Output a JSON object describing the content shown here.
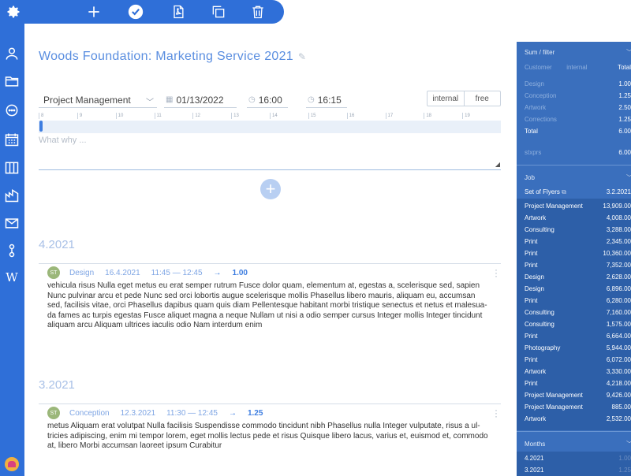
{
  "toolbar": {
    "icons": [
      "plus-icon",
      "check-circle-icon",
      "pdf-icon",
      "copy-icon",
      "trash-icon"
    ]
  },
  "sidebar": {
    "icons": [
      "gear-icon",
      "user-icon",
      "folder-icon",
      "chat-icon",
      "calendar-icon",
      "columns-icon",
      "factory-icon",
      "mail-icon",
      "link-icon",
      "wikipedia-icon"
    ]
  },
  "main": {
    "title": "Woods Foundation: Marketing Service 2021",
    "form": {
      "project": "Project Management",
      "date": "01/13/2022",
      "time_start": "16:00",
      "time_end": "16:15",
      "toggle": [
        "internal",
        "free"
      ],
      "placeholder": "What why ..."
    },
    "timeline_hours": [
      "8",
      "9",
      "10",
      "11",
      "12",
      "13",
      "14",
      "15",
      "16",
      "17",
      "18",
      "19"
    ],
    "groups": [
      {
        "month": "4.2021",
        "entry": {
          "initials": "ST",
          "type": "Design",
          "date": "16.4.2021",
          "time": "11:45 — 12:45",
          "arrow": "→",
          "hours": "1.00",
          "lines": [
            "vehicula risus Nulla eget metus eu erat semper rutrum Fusce dolor quam, elementum at, egestas a, scelerisque sed, sapien",
            "Nunc pulvinar arcu et pede Nunc sed orci lobortis augue scelerisque mollis Phasellus libero mauris, aliquam eu, accumsan",
            "sed, facilisis vitae, orci Phasellus dapibus quam quis diam Pellentesque habitant morbi tristique senectus et netus et malesua-",
            "da fames ac turpis egestas Fusce aliquet magna a neque Nullam ut nisi a odio semper cursus Integer mollis Integer tincidunt",
            "aliquam arcu Aliquam ultrices iaculis odio Nam interdum enim"
          ]
        }
      },
      {
        "month": "3.2021",
        "entry": {
          "initials": "ST",
          "type": "Conception",
          "date": "12.3.2021",
          "time": "11:30 — 12:45",
          "arrow": "→",
          "hours": "1.25",
          "lines": [
            "metus Aliquam erat volutpat Nulla facilisis Suspendisse commodo tincidunt nibh Phasellus nulla Integer vulputate, risus a ul-",
            "tricies adipiscing, enim mi tempor lorem, eget mollis lectus pede et risus Quisque libero lacus, varius et, euismod et, commodo",
            "at, libero Morbi accumsan laoreet ipsum Curabitur"
          ]
        }
      }
    ]
  },
  "right_panel": {
    "sum": {
      "header": "Sum / filter",
      "columns": [
        "Customer",
        "internal",
        "Total"
      ],
      "rows": [
        {
          "label": "Design",
          "value": "1.00",
          "dim": true
        },
        {
          "label": "Conception",
          "value": "1.25",
          "dim": true
        },
        {
          "label": "Artwork",
          "value": "2.50",
          "dim": true
        },
        {
          "label": "Corrections",
          "value": "1.25",
          "dim": true
        },
        {
          "label": "Total",
          "value": "6.00",
          "dim": false
        },
        {
          "label": "stxprs",
          "value": "6.00",
          "dim": true
        }
      ]
    },
    "job": {
      "header": "Job",
      "set_label": "Set of Flyers",
      "set_value": "3.2.2021",
      "rows": [
        {
          "label": "Project Management",
          "value": "13,909.00"
        },
        {
          "label": "Artwork",
          "value": "4,008.00"
        },
        {
          "label": "Consulting",
          "value": "3,288.00"
        },
        {
          "label": "Print",
          "value": "2,345.00"
        },
        {
          "label": "Print",
          "value": "10,360.00"
        },
        {
          "label": "Print",
          "value": "7,352.00"
        },
        {
          "label": "Design",
          "value": "2,628.00"
        },
        {
          "label": "Design",
          "value": "6,896.00"
        },
        {
          "label": "Print",
          "value": "6,280.00"
        },
        {
          "label": "Consulting",
          "value": "7,160.00"
        },
        {
          "label": "Consulting",
          "value": "1,575.00"
        },
        {
          "label": "Print",
          "value": "6,664.00"
        },
        {
          "label": "Photography",
          "value": "5,944.00"
        },
        {
          "label": "Print",
          "value": "6,072.00"
        },
        {
          "label": "Artwork",
          "value": "3,330.00"
        },
        {
          "label": "Print",
          "value": "4,218.00"
        },
        {
          "label": "Project Management",
          "value": "9,426.00"
        },
        {
          "label": "Project Management",
          "value": "885.00"
        },
        {
          "label": "Artwork",
          "value": "2,532.00"
        }
      ]
    },
    "months": {
      "header": "Months",
      "rows": [
        {
          "label": "4.2021",
          "value": "1.00"
        },
        {
          "label": "3.2021",
          "value": "1.25"
        }
      ]
    }
  }
}
